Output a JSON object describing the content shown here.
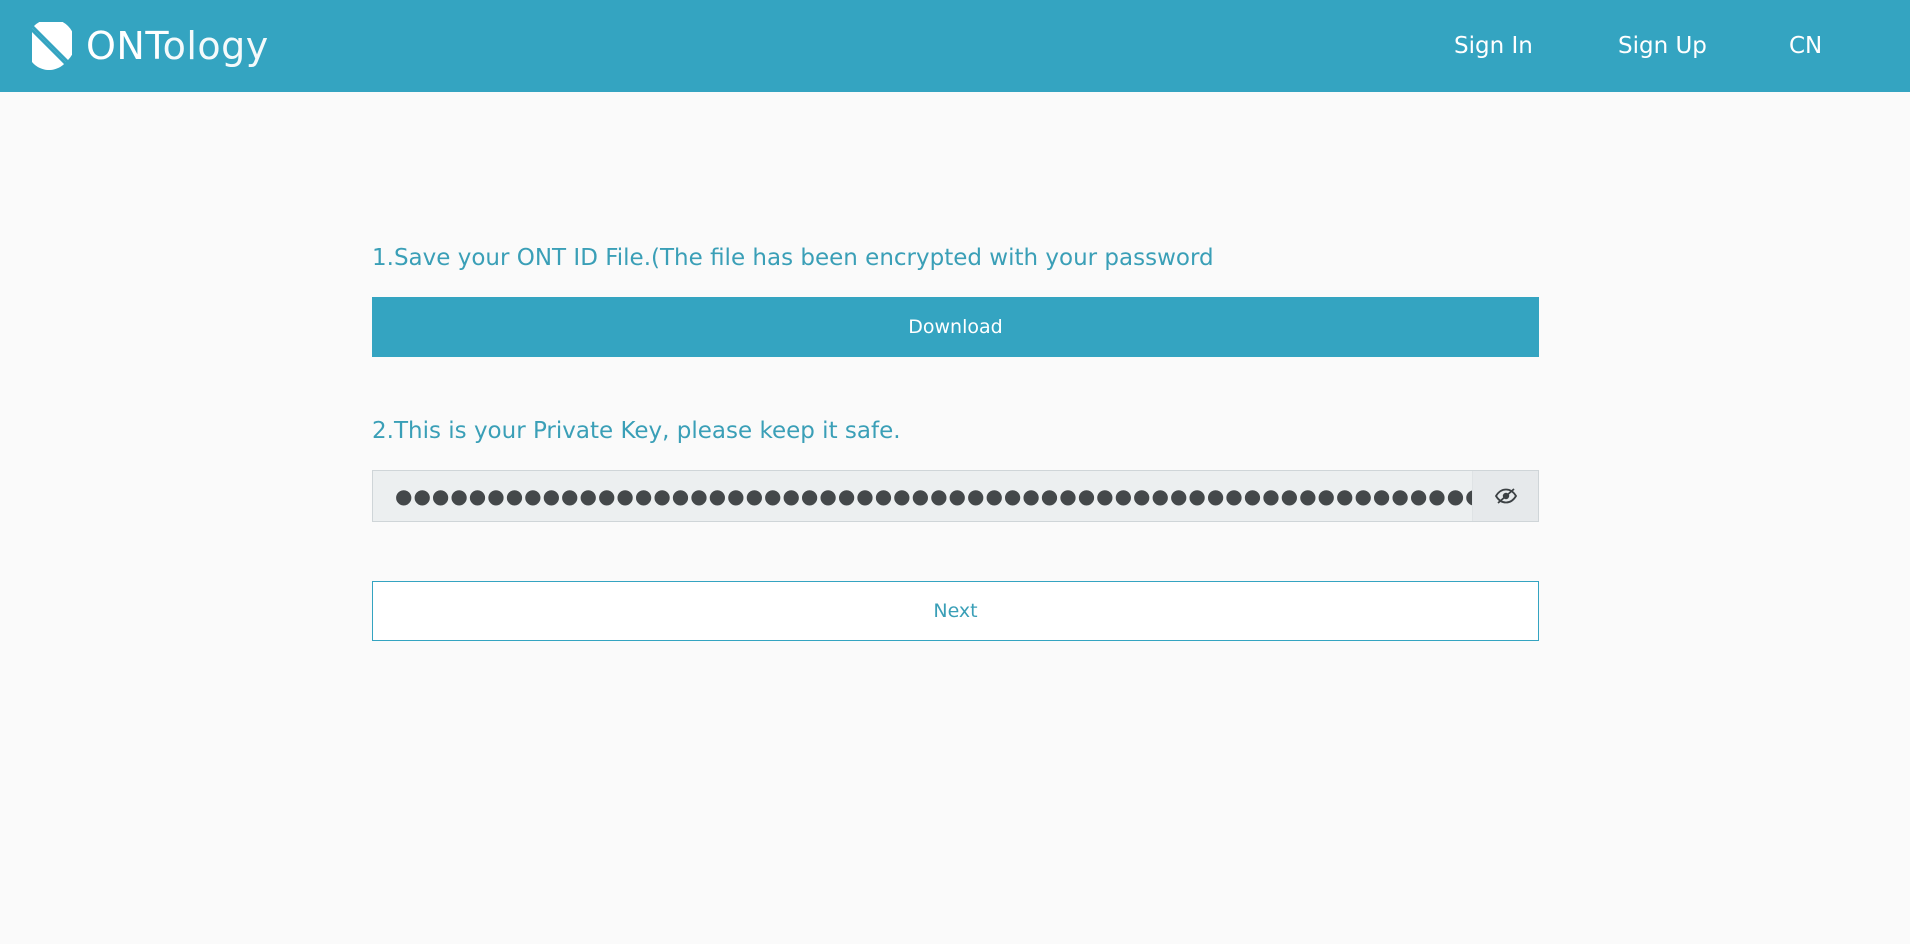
{
  "header": {
    "logo": {
      "brand_bold": "ONT",
      "brand_light": "ology",
      "icon": "ontology-logo-icon"
    },
    "nav": {
      "sign_in": "Sign In",
      "sign_up": "Sign Up",
      "language": "CN"
    }
  },
  "main": {
    "step1_label": "1.Save your ONT ID File.(The file has been encrypted with your password",
    "download_button": "Download",
    "step2_label": "2.This is your Private Key, please keep it safe.",
    "private_key_masked": "●●●●●●●●●●●●●●●●●●●●●●●●●●●●●●●●●●●●●●●●●●●●●●●●●●●●●●●●●●●●●●●●",
    "toggle_visibility_icon": "eye-slash-icon",
    "next_button": "Next"
  },
  "colors": {
    "brand": "#34a4c1",
    "label_text": "#3a9fb7",
    "background": "#fafafa",
    "input_bg": "#eceff0"
  }
}
